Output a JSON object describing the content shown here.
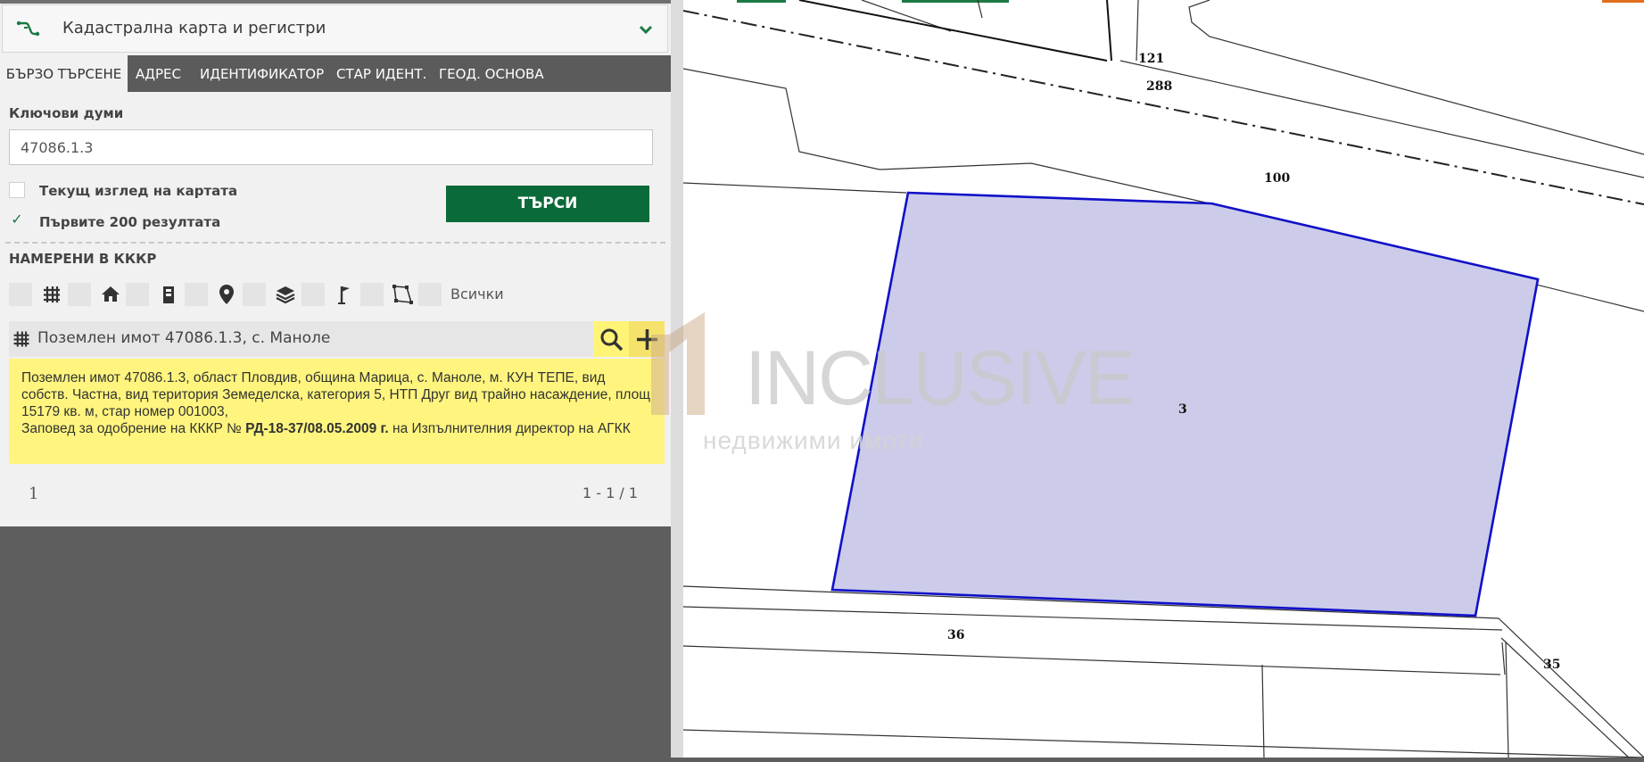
{
  "header": {
    "title": "Кадастрална карта и регистри"
  },
  "tabs": [
    {
      "label": "БЪРЗО ТЪРСЕНЕ"
    },
    {
      "label": "АДРЕС"
    },
    {
      "label": "ИДЕНТИФИКАТОР"
    },
    {
      "label": "СТАР ИДЕНТ."
    },
    {
      "label": "ГЕОД. ОСНОВА"
    }
  ],
  "search": {
    "keywords_label": "Ключови думи",
    "keywords_value": "47086.1.3",
    "current_view_label": "Текущ изглед на картата",
    "current_view_checked": false,
    "first200_label": "Първите 200 резултата",
    "first200_checked": true,
    "first200_mark": "✓",
    "button_label": "ТЪРСИ"
  },
  "results": {
    "heading": "НАМЕРЕНИ В КККР",
    "filter_all_label": "Всички",
    "filter_icons": [
      "grid-icon",
      "house-icon",
      "building-icon",
      "pin-icon",
      "layers-icon",
      "flag-icon",
      "polygon-icon"
    ],
    "item": {
      "title": "Поземлен имот 47086.1.3, с. Маноле",
      "description_main": "Поземлен имот 47086.1.3, област Пловдив, община Марица, с. Маноле, м. КУН ТЕПЕ, вид собств. Частна, вид територия Земеделска, категория 5, НТП Друг вид трайно насаждение, площ 15179 кв. м, стар номер 001003,",
      "order_prefix": "Заповед за одобрение на КККР №",
      "order_number": "РД-18-37/08.05.2009 г.",
      "order_suffix": "на Изпълнителния директор на АГКК"
    },
    "page_number": "1",
    "page_range": "1 - 1 / 1"
  },
  "map": {
    "labels": [
      "121",
      "288",
      "100",
      "3",
      "36",
      "35"
    ],
    "highlight_color": "#ccccea",
    "highlight_stroke": "#1010c8"
  },
  "watermark": {
    "brand": "INCLUSIVE",
    "tagline": "недвижими имоти"
  },
  "colors": {
    "accent": "#0b6a39",
    "result_bg": "#fff57e",
    "tabs_bg": "#5b5b5b"
  }
}
